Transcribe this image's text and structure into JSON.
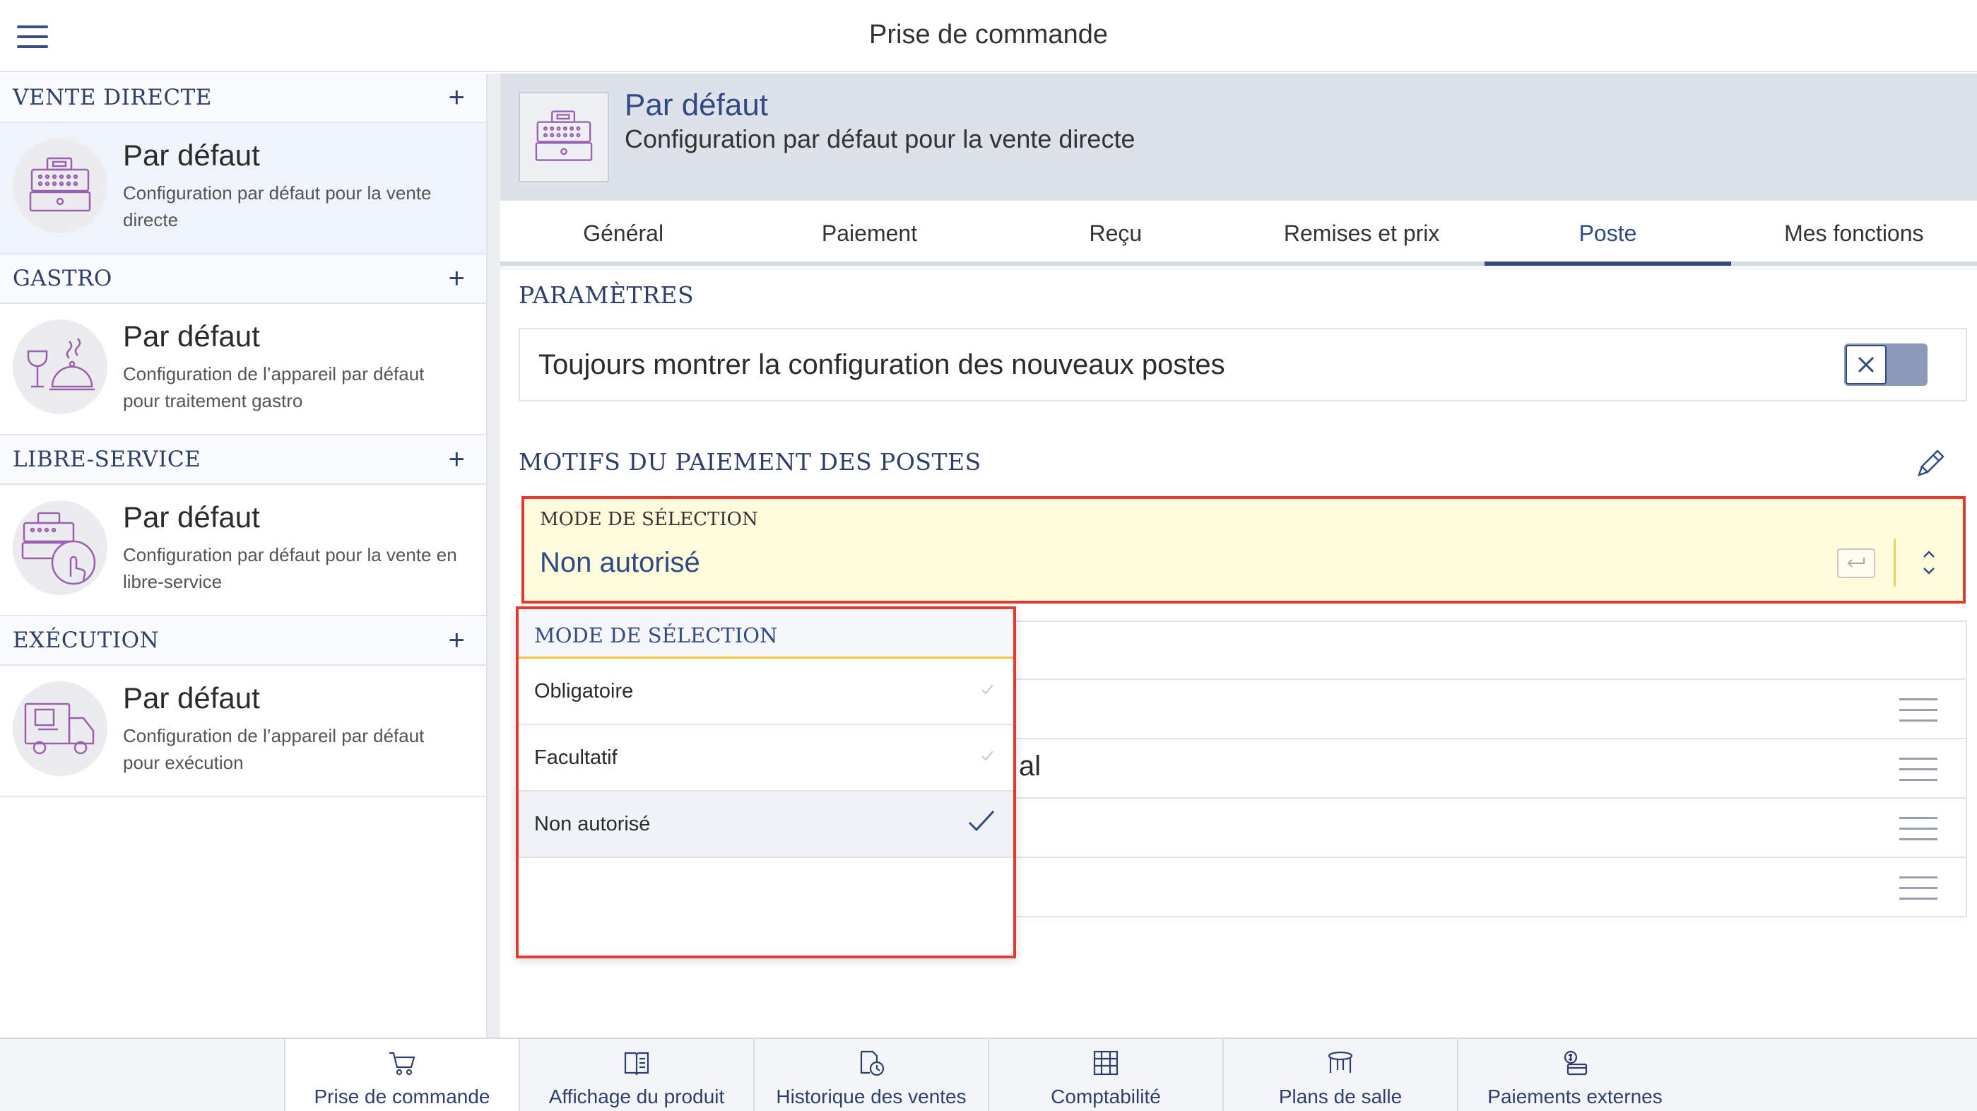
{
  "app": {
    "title": "Prise de commande"
  },
  "sidebar": {
    "sections": [
      {
        "title": "VENTE DIRECTE",
        "item": {
          "title": "Par défaut",
          "sub1": "Configuration par défaut pour la vente",
          "sub2": "directe"
        }
      },
      {
        "title": "GASTRO",
        "item": {
          "title": "Par défaut",
          "sub1": "Configuration de l’appareil par défaut",
          "sub2": "pour traitement gastro"
        }
      },
      {
        "title": "LIBRE-SERVICE",
        "item": {
          "title": "Par défaut",
          "sub1": "Configuration par défaut pour la vente en",
          "sub2": "libre-service"
        }
      },
      {
        "title": "EXÉCUTION",
        "item": {
          "title": "Par défaut",
          "sub1": "Configuration de l’appareil par défaut",
          "sub2": "pour exécution"
        }
      }
    ],
    "add_symbol": "+"
  },
  "header": {
    "title": "Par défaut",
    "subtitle": "Configuration par défaut pour la vente directe"
  },
  "tabs": [
    "Général",
    "Paiement",
    "Reçu",
    "Remises et prix",
    "Poste",
    "Mes fonctions"
  ],
  "active_tab": "Poste",
  "settings": {
    "section_title": "PARAMÈTRES",
    "toggle_label": "Toujours montrer la configuration des nouveaux postes",
    "toggle_state": "off"
  },
  "reasons": {
    "section_title": "MOTIFS DU PAIEMENT DES POSTES",
    "field_label": "MODE DE SÉLECTION",
    "field_value": "Non autorisé",
    "partial_row_text": "al"
  },
  "dropdown": {
    "header": "MODE DE SÉLECTION",
    "options": [
      {
        "label": "Obligatoire",
        "selected": false
      },
      {
        "label": "Facultatif",
        "selected": false
      },
      {
        "label": "Non autorisé",
        "selected": true
      }
    ]
  },
  "bottom_nav": [
    {
      "label": "Prise de commande",
      "icon": "cart-icon",
      "active": true
    },
    {
      "label": "Affichage du produit",
      "icon": "product-display-icon",
      "active": false
    },
    {
      "label": "Historique des ventes",
      "icon": "sales-history-icon",
      "active": false
    },
    {
      "label": "Comptabilité",
      "icon": "accounting-icon",
      "active": false
    },
    {
      "label": "Plans de salle",
      "icon": "table-icon",
      "active": false
    },
    {
      "label": "Paiements externes",
      "icon": "external-payment-icon",
      "active": false
    }
  ],
  "colors": {
    "accent": "#2f4a85",
    "highlight_border": "#e23a2e",
    "field_bg": "#fffbdd",
    "active_tab_bar": "#34497a"
  }
}
